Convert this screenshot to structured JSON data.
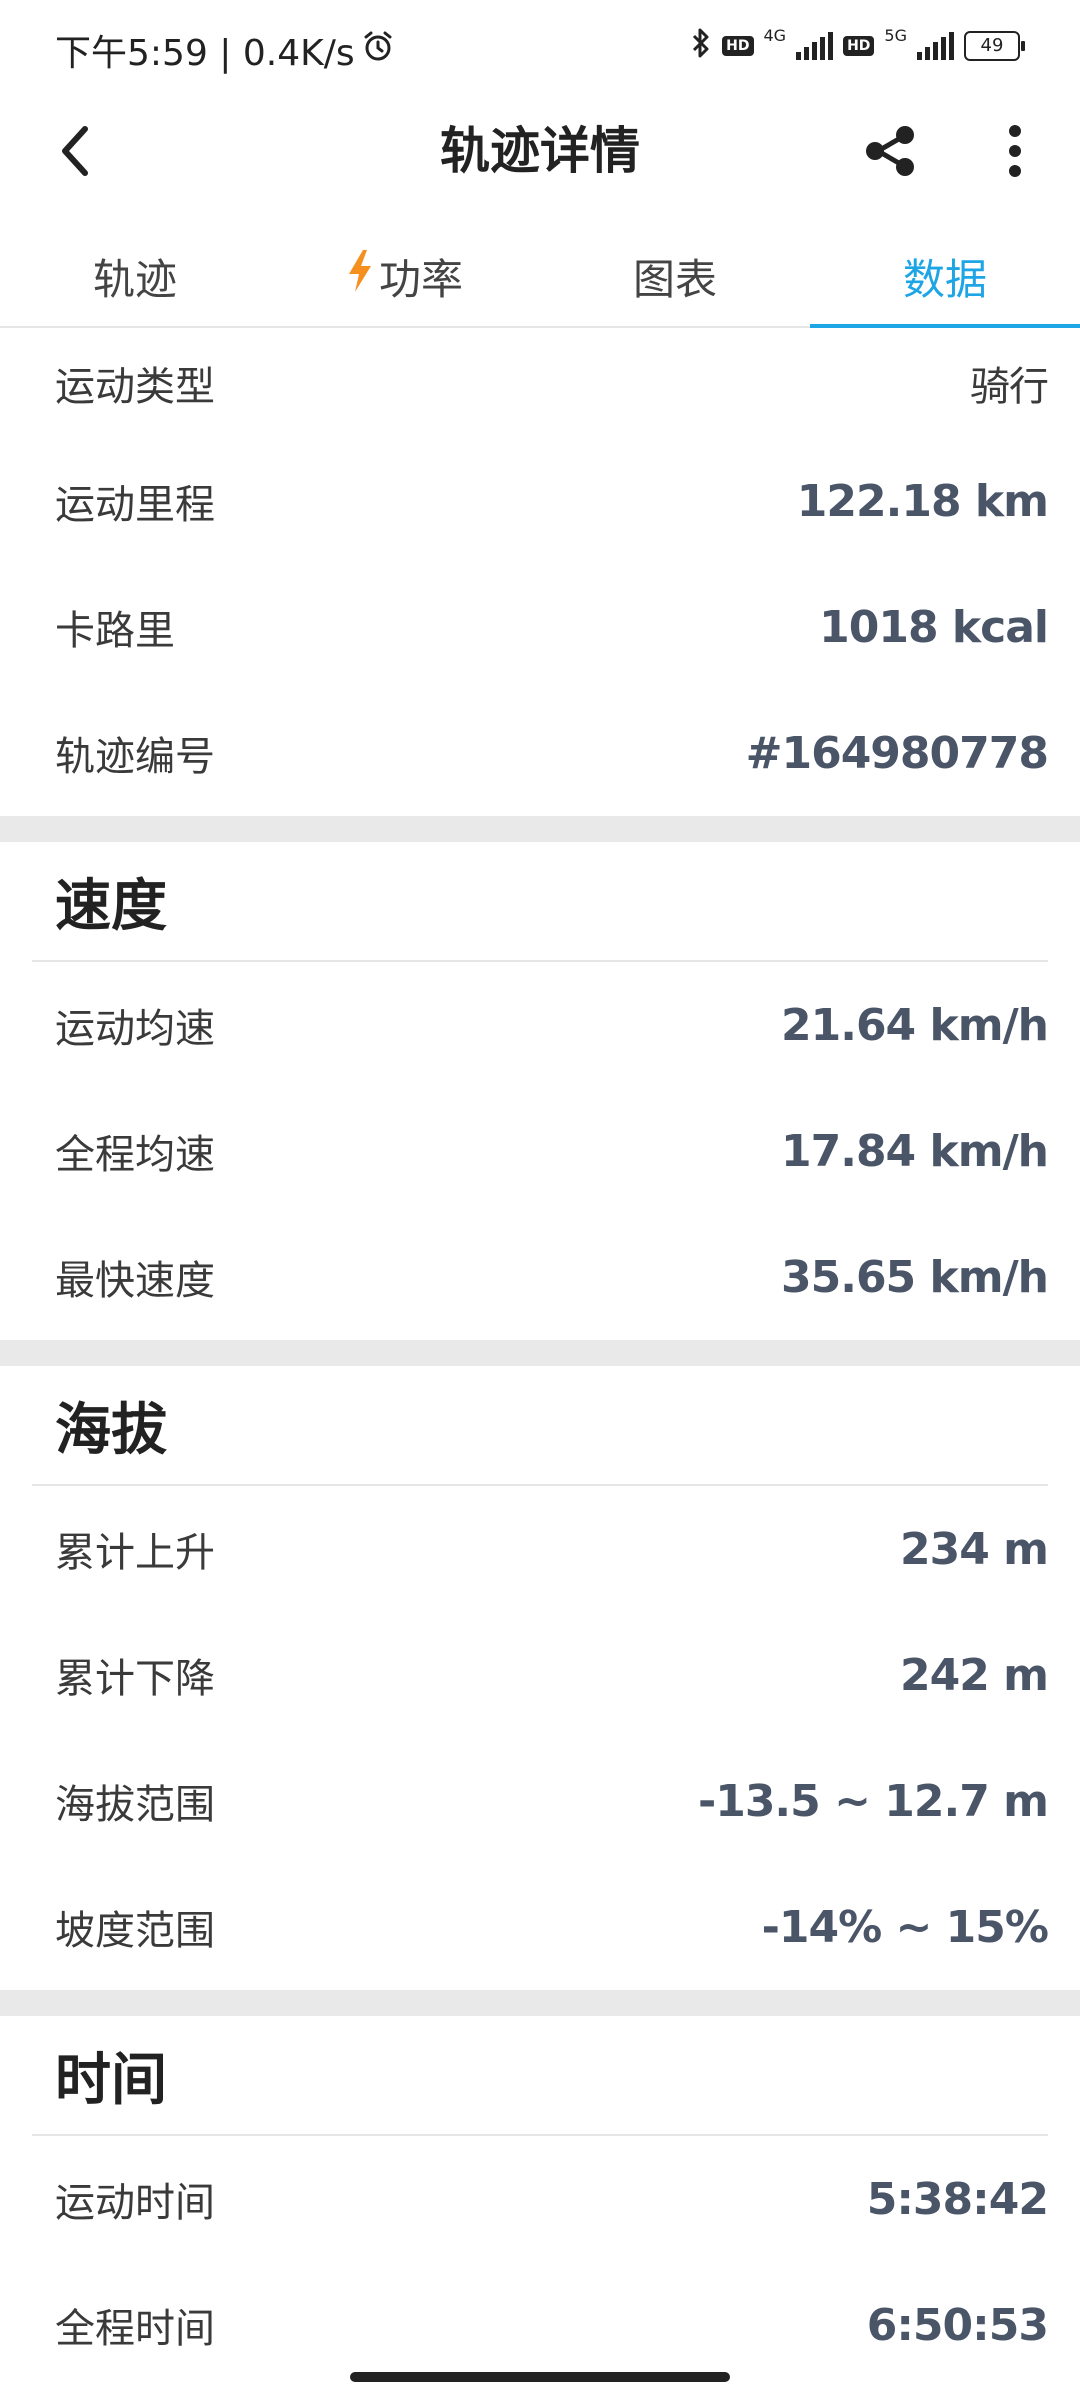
{
  "status_bar": {
    "time_speed": "下午5:59 | 0.4K/s",
    "hd1": "HD",
    "net1": "4G",
    "hd2": "HD",
    "net2": "5G",
    "battery": "49",
    "icons": [
      "alarm-icon",
      "bluetooth-icon",
      "signal-icon",
      "battery-icon"
    ]
  },
  "app_bar": {
    "title": "轨迹详情"
  },
  "tabs": [
    {
      "label": "轨迹",
      "active": false
    },
    {
      "label": "功率",
      "active": false,
      "icon": "lightning-icon"
    },
    {
      "label": "图表",
      "active": false
    },
    {
      "label": "数据",
      "active": true
    }
  ],
  "colors": {
    "accent": "#1ea5e6",
    "lightning": "#f5901e",
    "value": "#4a5568"
  },
  "summary": [
    {
      "label": "运动类型",
      "value": "骑行"
    },
    {
      "label": "运动里程",
      "value": "122.18 km"
    },
    {
      "label": "卡路里",
      "value": "1018 kcal"
    },
    {
      "label": "轨迹编号",
      "value": "#164980778"
    }
  ],
  "speed": {
    "title": "速度",
    "rows": [
      {
        "label": "运动均速",
        "value": "21.64 km/h"
      },
      {
        "label": "全程均速",
        "value": "17.84 km/h"
      },
      {
        "label": "最快速度",
        "value": "35.65 km/h"
      }
    ]
  },
  "altitude": {
    "title": "海拔",
    "rows": [
      {
        "label": "累计上升",
        "value": "234 m"
      },
      {
        "label": "累计下降",
        "value": "242 m"
      },
      {
        "label": "海拔范围",
        "value": "-13.5 ~ 12.7 m"
      },
      {
        "label": "坡度范围",
        "value": "-14% ~ 15%"
      }
    ]
  },
  "time": {
    "title": "时间",
    "rows": [
      {
        "label": "运动时间",
        "value": "5:38:42"
      },
      {
        "label": "全程时间",
        "value": "6:50:53"
      }
    ]
  }
}
